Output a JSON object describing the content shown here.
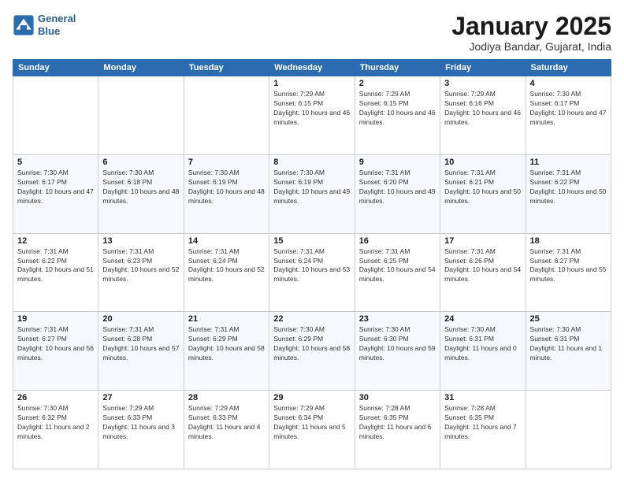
{
  "logo": {
    "line1": "General",
    "line2": "Blue"
  },
  "title": "January 2025",
  "subtitle": "Jodiya Bandar, Gujarat, India",
  "weekdays": [
    "Sunday",
    "Monday",
    "Tuesday",
    "Wednesday",
    "Thursday",
    "Friday",
    "Saturday"
  ],
  "weeks": [
    [
      {
        "day": "",
        "sunrise": "",
        "sunset": "",
        "daylight": ""
      },
      {
        "day": "",
        "sunrise": "",
        "sunset": "",
        "daylight": ""
      },
      {
        "day": "",
        "sunrise": "",
        "sunset": "",
        "daylight": ""
      },
      {
        "day": "1",
        "sunrise": "Sunrise: 7:29 AM",
        "sunset": "Sunset: 6:15 PM",
        "daylight": "Daylight: 10 hours and 46 minutes."
      },
      {
        "day": "2",
        "sunrise": "Sunrise: 7:29 AM",
        "sunset": "Sunset: 6:15 PM",
        "daylight": "Daylight: 10 hours and 46 minutes."
      },
      {
        "day": "3",
        "sunrise": "Sunrise: 7:29 AM",
        "sunset": "Sunset: 6:16 PM",
        "daylight": "Daylight: 10 hours and 46 minutes."
      },
      {
        "day": "4",
        "sunrise": "Sunrise: 7:30 AM",
        "sunset": "Sunset: 6:17 PM",
        "daylight": "Daylight: 10 hours and 47 minutes."
      }
    ],
    [
      {
        "day": "5",
        "sunrise": "Sunrise: 7:30 AM",
        "sunset": "Sunset: 6:17 PM",
        "daylight": "Daylight: 10 hours and 47 minutes."
      },
      {
        "day": "6",
        "sunrise": "Sunrise: 7:30 AM",
        "sunset": "Sunset: 6:18 PM",
        "daylight": "Daylight: 10 hours and 48 minutes."
      },
      {
        "day": "7",
        "sunrise": "Sunrise: 7:30 AM",
        "sunset": "Sunset: 6:19 PM",
        "daylight": "Daylight: 10 hours and 48 minutes."
      },
      {
        "day": "8",
        "sunrise": "Sunrise: 7:30 AM",
        "sunset": "Sunset: 6:19 PM",
        "daylight": "Daylight: 10 hours and 49 minutes."
      },
      {
        "day": "9",
        "sunrise": "Sunrise: 7:31 AM",
        "sunset": "Sunset: 6:20 PM",
        "daylight": "Daylight: 10 hours and 49 minutes."
      },
      {
        "day": "10",
        "sunrise": "Sunrise: 7:31 AM",
        "sunset": "Sunset: 6:21 PM",
        "daylight": "Daylight: 10 hours and 50 minutes."
      },
      {
        "day": "11",
        "sunrise": "Sunrise: 7:31 AM",
        "sunset": "Sunset: 6:22 PM",
        "daylight": "Daylight: 10 hours and 50 minutes."
      }
    ],
    [
      {
        "day": "12",
        "sunrise": "Sunrise: 7:31 AM",
        "sunset": "Sunset: 6:22 PM",
        "daylight": "Daylight: 10 hours and 51 minutes."
      },
      {
        "day": "13",
        "sunrise": "Sunrise: 7:31 AM",
        "sunset": "Sunset: 6:23 PM",
        "daylight": "Daylight: 10 hours and 52 minutes."
      },
      {
        "day": "14",
        "sunrise": "Sunrise: 7:31 AM",
        "sunset": "Sunset: 6:24 PM",
        "daylight": "Daylight: 10 hours and 52 minutes."
      },
      {
        "day": "15",
        "sunrise": "Sunrise: 7:31 AM",
        "sunset": "Sunset: 6:24 PM",
        "daylight": "Daylight: 10 hours and 53 minutes."
      },
      {
        "day": "16",
        "sunrise": "Sunrise: 7:31 AM",
        "sunset": "Sunset: 6:25 PM",
        "daylight": "Daylight: 10 hours and 54 minutes."
      },
      {
        "day": "17",
        "sunrise": "Sunrise: 7:31 AM",
        "sunset": "Sunset: 6:26 PM",
        "daylight": "Daylight: 10 hours and 54 minutes."
      },
      {
        "day": "18",
        "sunrise": "Sunrise: 7:31 AM",
        "sunset": "Sunset: 6:27 PM",
        "daylight": "Daylight: 10 hours and 55 minutes."
      }
    ],
    [
      {
        "day": "19",
        "sunrise": "Sunrise: 7:31 AM",
        "sunset": "Sunset: 6:27 PM",
        "daylight": "Daylight: 10 hours and 56 minutes."
      },
      {
        "day": "20",
        "sunrise": "Sunrise: 7:31 AM",
        "sunset": "Sunset: 6:28 PM",
        "daylight": "Daylight: 10 hours and 57 minutes."
      },
      {
        "day": "21",
        "sunrise": "Sunrise: 7:31 AM",
        "sunset": "Sunset: 6:29 PM",
        "daylight": "Daylight: 10 hours and 58 minutes."
      },
      {
        "day": "22",
        "sunrise": "Sunrise: 7:30 AM",
        "sunset": "Sunset: 6:29 PM",
        "daylight": "Daylight: 10 hours and 58 minutes."
      },
      {
        "day": "23",
        "sunrise": "Sunrise: 7:30 AM",
        "sunset": "Sunset: 6:30 PM",
        "daylight": "Daylight: 10 hours and 59 minutes."
      },
      {
        "day": "24",
        "sunrise": "Sunrise: 7:30 AM",
        "sunset": "Sunset: 6:31 PM",
        "daylight": "Daylight: 11 hours and 0 minutes."
      },
      {
        "day": "25",
        "sunrise": "Sunrise: 7:30 AM",
        "sunset": "Sunset: 6:31 PM",
        "daylight": "Daylight: 11 hours and 1 minute."
      }
    ],
    [
      {
        "day": "26",
        "sunrise": "Sunrise: 7:30 AM",
        "sunset": "Sunset: 6:32 PM",
        "daylight": "Daylight: 11 hours and 2 minutes."
      },
      {
        "day": "27",
        "sunrise": "Sunrise: 7:29 AM",
        "sunset": "Sunset: 6:33 PM",
        "daylight": "Daylight: 11 hours and 3 minutes."
      },
      {
        "day": "28",
        "sunrise": "Sunrise: 7:29 AM",
        "sunset": "Sunset: 6:33 PM",
        "daylight": "Daylight: 11 hours and 4 minutes."
      },
      {
        "day": "29",
        "sunrise": "Sunrise: 7:29 AM",
        "sunset": "Sunset: 6:34 PM",
        "daylight": "Daylight: 11 hours and 5 minutes."
      },
      {
        "day": "30",
        "sunrise": "Sunrise: 7:28 AM",
        "sunset": "Sunset: 6:35 PM",
        "daylight": "Daylight: 11 hours and 6 minutes."
      },
      {
        "day": "31",
        "sunrise": "Sunrise: 7:28 AM",
        "sunset": "Sunset: 6:35 PM",
        "daylight": "Daylight: 11 hours and 7 minutes."
      },
      {
        "day": "",
        "sunrise": "",
        "sunset": "",
        "daylight": ""
      }
    ]
  ]
}
